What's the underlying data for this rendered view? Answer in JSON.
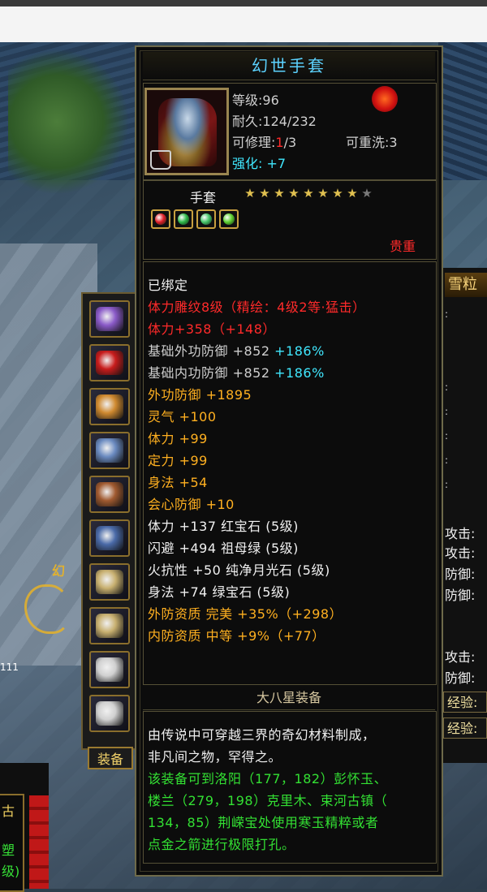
{
  "item": {
    "name": "幻世手套",
    "level_label": "等级:96",
    "durability_label": "耐久:124/232",
    "repair_prefix": "可修理:",
    "repair_current": "1",
    "repair_suffix": "/3",
    "rewash_label": "可重洗:3",
    "enhance_prefix": "强化: ",
    "enhance_value": "+7",
    "type_label": "手套",
    "stars_total": 9,
    "stars_filled": 8,
    "rarity_label": "贵重",
    "icon": "gauntlet-icon"
  },
  "gems": [
    {
      "name": "ruby-gem-icon",
      "color": "#e0202a"
    },
    {
      "name": "emerald-gem-icon",
      "color": "#2fb84a"
    },
    {
      "name": "jade-gem-icon",
      "color": "#46c46a"
    },
    {
      "name": "moonstone-gem-icon",
      "color": "#5ed030"
    }
  ],
  "attributes": [
    {
      "text": "已绑定",
      "color": "#f0f0f0"
    },
    {
      "text": "体力雕纹8级（精绘：4级2等·猛击）",
      "color": "#ff2a2a"
    },
    {
      "text": "体力+358（+148）",
      "color": "#ff2a2a"
    },
    {
      "text": "基础外功防御 +852",
      "color": "#cfcfcf",
      "extra": " +186%",
      "extra_color": "#40e8ff"
    },
    {
      "text": "基础内功防御 +852",
      "color": "#cfcfcf",
      "extra": " +186%",
      "extra_color": "#40e8ff"
    },
    {
      "text": "外功防御 +1895",
      "color": "#ffb020"
    },
    {
      "text": "灵气 +100",
      "color": "#ffb020"
    },
    {
      "text": "体力 +99",
      "color": "#ffb020"
    },
    {
      "text": "定力 +99",
      "color": "#ffb020"
    },
    {
      "text": "身法 +54",
      "color": "#ffb020"
    },
    {
      "text": "会心防御 +10",
      "color": "#ffb020"
    },
    {
      "text": "体力 +137 红宝石 (5级)",
      "color": "#f0f0f0"
    },
    {
      "text": "闪避 +494 祖母绿 (5级)",
      "color": "#f0f0f0"
    },
    {
      "text": "火抗性 +50 纯净月光石 (5级)",
      "color": "#f0f0f0"
    },
    {
      "text": "身法 +74 绿宝石 (5级)",
      "color": "#f0f0f0"
    },
    {
      "text": "外防资质    完美 +35%（+298）",
      "color": "#ffb020"
    },
    {
      "text": "内防资质    中等 +9%（+77）",
      "color": "#ffb020"
    }
  ],
  "footer": {
    "title": "大八星装备",
    "desc_white": [
      "由传说中可穿越三界的奇幻材料制成，",
      "非凡间之物，罕得之。"
    ],
    "desc_green": [
      "该装备可到洛阳（177，182）彭怀玉、",
      "楼兰（279，198）克里木、束河古镇（",
      "134，85）荆嵘宝处使用寒玉精粹或者",
      "点金之箭进行极限打孔。"
    ]
  },
  "sidebar": {
    "tab_label": "装备",
    "slots": [
      {
        "name": "shoulder-armor-icon",
        "color": "#8a5ac8"
      },
      {
        "name": "scroll-armor-icon",
        "color": "#c81c1c"
      },
      {
        "name": "bracer-icon",
        "color": "#d08a30"
      },
      {
        "name": "gauntlet-icon",
        "color": "#6a8ac0"
      },
      {
        "name": "belt-icon",
        "color": "#a05a30"
      },
      {
        "name": "boots-icon",
        "color": "#4a6aa8"
      },
      {
        "name": "ring-icon",
        "color": "#c8b070"
      },
      {
        "name": "ring-icon",
        "color": "#c8b070"
      },
      {
        "name": "amulet-icon",
        "color": "#d0d0d0"
      },
      {
        "name": "amulet-icon",
        "color": "#d0d0d0"
      }
    ]
  },
  "right_panel": {
    "title": "雪粒",
    "attack_label": "攻击:",
    "defense_label": "防御:",
    "exp_label": "经验:"
  },
  "hud": {
    "number": "111",
    "label": "幻",
    "left_texts": [
      "古",
      "塑",
      "级)"
    ]
  }
}
